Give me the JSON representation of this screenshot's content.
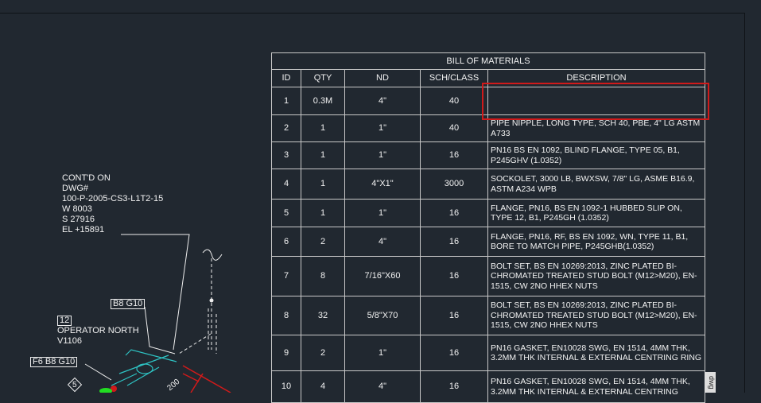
{
  "bom": {
    "title": "BILL OF MATERIALS",
    "headers": [
      "ID",
      "QTY",
      "ND",
      "SCH/CLASS",
      "DESCRIPTION"
    ],
    "rows": [
      {
        "id": "1",
        "qty": "0.3M",
        "nd": "4\"",
        "sch": "40",
        "desc": ""
      },
      {
        "id": "2",
        "qty": "1",
        "nd": "1\"",
        "sch": "40",
        "desc": "PIPE NIPPLE, LONG TYPE, SCH 40, PBE, 4\" LG ASTM A733"
      },
      {
        "id": "3",
        "qty": "1",
        "nd": "1\"",
        "sch": "16",
        "desc": "PN16  BS EN 1092, BLIND FLANGE, TYPE 05, B1, P245GHV (1.0352)"
      },
      {
        "id": "4",
        "qty": "1",
        "nd": "4\"X1\"",
        "sch": "3000",
        "desc": "SOCKOLET, 3000 LB, BWXSW, 7/8\" LG, ASME B16.9, ASTM  A234 WPB"
      },
      {
        "id": "5",
        "qty": "1",
        "nd": "1\"",
        "sch": "16",
        "desc": "FLANGE, PN16, BS EN 1092-1 HUBBED SLIP ON, TYPE 12, B1, P245GH (1.0352)"
      },
      {
        "id": "6",
        "qty": "2",
        "nd": "4\"",
        "sch": "16",
        "desc": "FLANGE, PN16, RF, BS EN 1092, WN, TYPE 11, B1, BORE TO MATCH PIPE, P245GHB(1.0352)"
      },
      {
        "id": "7",
        "qty": "8",
        "nd": "7/16\"X60",
        "sch": "16",
        "desc": "BOLT SET, BS EN 10269:2013, ZINC PLATED BI-CHROMATED TREATED STUD BOLT (M12>M20), EN-1515, CW 2NO HHEX NUTS"
      },
      {
        "id": "8",
        "qty": "32",
        "nd": "5/8\"X70",
        "sch": "16",
        "desc": "BOLT SET, BS EN 10269:2013, ZINC PLATED BI-CHROMATED TREATED STUD BOLT (M12>M20), EN-1515, CW 2NO HHEX NUTS"
      },
      {
        "id": "9",
        "qty": "2",
        "nd": "1\"",
        "sch": "16",
        "desc": "PN16 GASKET, EN10028 SWG, EN 1514, 4MM THK, 3.2MM THK INTERNAL & EXTERNAL CENTRING RING"
      },
      {
        "id": "10",
        "qty": "4",
        "nd": "4\"",
        "sch": "16",
        "desc": "PN16 GASKET, EN10028 SWG, EN 1514, 4MM THK, 3.2MM THK INTERNAL & EXTERNAL CENTRING"
      }
    ]
  },
  "drawing": {
    "contd_note": "CONT'D ON\nDWG#\n100-P-2005-CS3-L1T2-15\nW 8003\nS 27916\nEL +15891",
    "tag_b8_g10": "B8 G10",
    "tag_12": "12",
    "operator_note": "OPERATOR NORTH\nV1106",
    "tag_f6_b8_g10": "F6 B8 G10",
    "tag_5": "5",
    "dim_200": "200"
  },
  "file_tab": "dwg",
  "colors": {
    "background": "#212830",
    "pipe": "#2ec4c4",
    "dimension": "#d11a1a",
    "highlight": "#d11a1a"
  }
}
